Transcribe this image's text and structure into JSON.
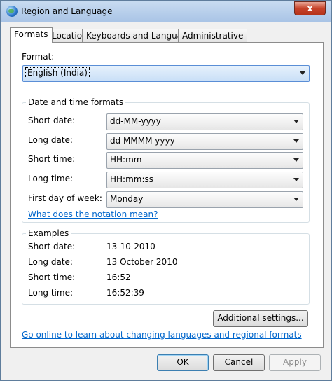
{
  "window": {
    "title": "Region and Language",
    "close_label": "x"
  },
  "tabs": [
    {
      "label": "Formats"
    },
    {
      "label": "Location"
    },
    {
      "label": "Keyboards and Languages"
    },
    {
      "label": "Administrative"
    }
  ],
  "format": {
    "label": "Format:",
    "value": "English (India)"
  },
  "date_time_formats": {
    "legend": "Date and time formats",
    "short_date": {
      "label": "Short date:",
      "value": "dd-MM-yyyy"
    },
    "long_date": {
      "label": "Long date:",
      "value": "dd MMMM yyyy"
    },
    "short_time": {
      "label": "Short time:",
      "value": "HH:mm"
    },
    "long_time": {
      "label": "Long time:",
      "value": "HH:mm:ss"
    },
    "first_day": {
      "label": "First day of week:",
      "value": "Monday"
    },
    "notation_link": "What does the notation mean?"
  },
  "examples": {
    "legend": "Examples",
    "short_date": {
      "label": "Short date:",
      "value": "13-10-2010"
    },
    "long_date": {
      "label": "Long date:",
      "value": "13 October 2010"
    },
    "short_time": {
      "label": "Short time:",
      "value": "16:52"
    },
    "long_time": {
      "label": "Long time:",
      "value": "16:52:39"
    }
  },
  "additional_settings_label": "Additional settings...",
  "online_link": "Go online to learn about changing languages and regional formats",
  "buttons": {
    "ok": "OK",
    "cancel": "Cancel",
    "apply": "Apply"
  }
}
